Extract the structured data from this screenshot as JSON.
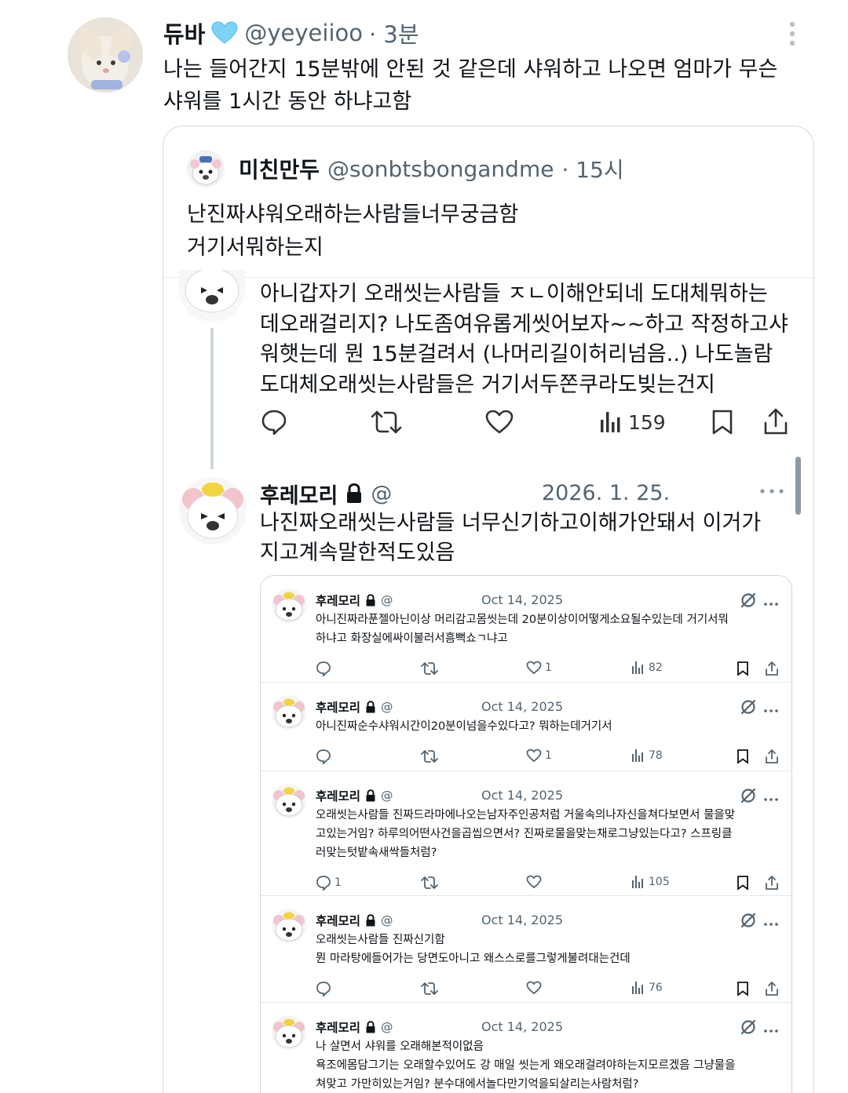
{
  "main_tweet": {
    "display_name": "듀바",
    "handle": "@yeyeiioo",
    "time": "· 3분",
    "text_line1": "나는 들어간지 15분밖에 안된 것 같은데 샤워하고 나오면 엄마가 무슨",
    "text_line2": "샤워를 1시간 동안 하냐고함",
    "more_icon": "vertical-dots-icon"
  },
  "quoted_tweet": {
    "display_name": "미친만두",
    "handle": "@sonbtsbongandme",
    "time": "· 15시",
    "text_line1": "난진짜샤워오래하는사람들너무궁금함",
    "text_line2": "거기서뭐하는지"
  },
  "screenshot_tweet_1": {
    "lines": [
      "아니갑자기 오래씻는사람들 ㅈㄴ이해안되네 도대체뭐하는",
      "데오래걸리지? 나도좀여유롭게씻어보자~~하고 작정하고샤",
      "워햇는데 뭔 15분걸려서 (나머리길이허리넘음..) 나도놀람",
      "도대체오래씻는사람들은 거기서두쫀쿠라도빚는건지"
    ],
    "views": "159"
  },
  "screenshot_tweet_2": {
    "display_name": "후레모리",
    "handle": "@",
    "date": "2026. 1. 25.",
    "line1": "나진짜오래씻는사람들 너무신기하고이해가안돼서 이거가",
    "line2": "지고계속말한적도있음"
  },
  "mini_tweets": [
    {
      "name": "후레모리",
      "handle": "@",
      "date": "Oct 14, 2025",
      "lines": [
        "아니진짜라푼젤아닌이상 머리감고몸씻는데 20분이상이어떻게소요될수있는데 거기서뭐",
        "하냐고 화장실에싸이불러서흠뻑쇼ㄱ냐고"
      ],
      "replies": "",
      "likes": "1",
      "views": "82"
    },
    {
      "name": "후레모리",
      "handle": "@",
      "date": "Oct 14, 2025",
      "lines": [
        "아니진짜순수샤워시간이20분이넘을수있다고? 뭐하는데거기서"
      ],
      "replies": "",
      "likes": "1",
      "views": "78"
    },
    {
      "name": "후레모리",
      "handle": "@",
      "date": "Oct 14, 2025",
      "lines": [
        "오래씻는사람들 진짜드라마에나오는남자주인공처럼 거울속의나자신을쳐다보면서 물을맞",
        "고있는거임? 하루의어떤사건을곱씹으면서? 진짜로물을맞는채로그냥있는다고? 스프링클",
        "러맞는텃밭속새싹들처럼?"
      ],
      "replies": "1",
      "likes": "",
      "views": "105"
    },
    {
      "name": "후레모리",
      "handle": "@",
      "date": "Oct 14, 2025",
      "lines": [
        "오래씻는사람들 진짜신기함",
        "뭔 마라탕에들어가는 당면도아니고 왜스스로를그렇게불려대는건데"
      ],
      "replies": "",
      "likes": "",
      "views": "76"
    },
    {
      "name": "후레모리",
      "handle": "@",
      "date": "Oct 14, 2025",
      "lines": [
        "나 살면서 샤워를 오래해본적이없음",
        "욕조에몸담그기는 오래할수있어도 강 매일 씻는게 왜오래걸려야하는지모르겠음 그냥물을",
        "쳐맞고 가만히있는거임? 분수대에서놀다만기억을되살리는사람처럼?"
      ],
      "replies": "",
      "likes": "",
      "views": ""
    }
  ],
  "colors": {
    "text": "#0f1419",
    "muted": "#536471",
    "border": "#cfd9de",
    "verified_heart": "#7dd3f5"
  }
}
